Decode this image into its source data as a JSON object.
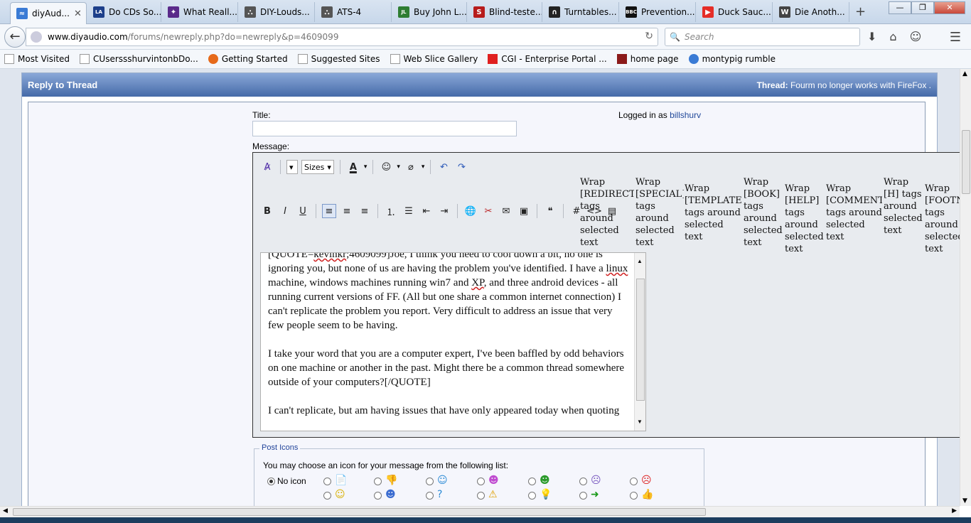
{
  "browser": {
    "tabs": [
      {
        "label": "diyAud...",
        "favicon": "diyaudio-icon",
        "color": "#3a7bd5"
      },
      {
        "label": "Do CDs So...",
        "favicon": "la-icon",
        "color": "#1d3f8a"
      },
      {
        "label": "What Reall...",
        "favicon": "dancer-icon",
        "color": "#5a2a8a"
      },
      {
        "label": "DIY-Louds...",
        "favicon": "tower-icon",
        "color": "#555555"
      },
      {
        "label": "ATS-4",
        "favicon": "tower-icon",
        "color": "#555555"
      },
      {
        "label": "Buy John L...",
        "favicon": "jl-icon",
        "color": "#2e7d32"
      },
      {
        "label": "Blind-teste...",
        "favicon": "s-icon",
        "color": "#b71c1c"
      },
      {
        "label": "Turntables...",
        "favicon": "headphones-icon",
        "color": "#222222"
      },
      {
        "label": "Prevention...",
        "favicon": "bbc-icon",
        "color": "#111111"
      },
      {
        "label": "Duck Sauc...",
        "favicon": "youtube-icon",
        "color": "#e52d27"
      },
      {
        "label": "Die Anoth...",
        "favicon": "wikipedia-icon",
        "color": "#444444"
      }
    ],
    "url_host": "www.diyaudio.com",
    "url_path": "/forums/newreply.php?do=newreply&p=4609099",
    "search_placeholder": "Search",
    "bookmarks": [
      "Most Visited",
      "CUserssshurvintonbDo...",
      "Getting Started",
      "Suggested Sites",
      "Web Slice Gallery",
      "CGI - Enterprise Portal ...",
      "home page",
      "montypig rumble"
    ]
  },
  "panel": {
    "title": "Reply to Thread",
    "thread_label": "Thread:",
    "thread_title": "Fourm no longer works with FireFox ."
  },
  "form": {
    "title_label": "Title:",
    "title_value": "",
    "logged_in_label": "Logged in as",
    "username": "billshurv",
    "message_label": "Message:",
    "sizes_label": "Sizes"
  },
  "wrap_buttons": [
    "Wrap [REDIRECT] tags around selected text",
    "Wrap [SPECIAL] tags around selected text",
    "Wrap [TEMPLATE] tags around selected text",
    "Wrap [BOOK] tags around selected text",
    "Wrap [HELP] tags around selected text",
    "Wrap [COMMENT] tags around selected text",
    "Wrap [H] tags around selected text",
    "Wrap [FOOTNOTE] tags around selected text"
  ],
  "message": {
    "quote_open_pre": "[QUOTE=",
    "quote_author": "kevinkr",
    "quote_open_post": ";4609099]Joe, I think you need to cool down a bit, no one is ignoring you, but none of us are having the problem you've identified. I have a ",
    "word_linux": "linux",
    "mid1": " machine, windows machines running win7 and ",
    "word_xp": "XP",
    "mid2": ", and three android devices - all running current versions of FF. (All but one share a common internet connection) I can't replicate the problem you report. Very difficult to address an issue that very few people seem to be having.",
    "para2": "I take your word that you are a computer expert, I've been baffled by odd behaviors on one machine or another in the past. Might there be a common thread somewhere outside of your computers?[/QUOTE]",
    "para3": "I can't replicate, but am having issues that have only appeared today when quoting"
  },
  "post_icons": {
    "legend": "Post Icons",
    "instruction": "You may choose an icon for your message from the following list:",
    "no_icon_label": "No icon",
    "icons": [
      "document-icon",
      "thumbs-down-icon",
      "smile-icon",
      "grin-icon",
      "alien-icon",
      "frown-icon",
      "angry-icon",
      "happy-icon",
      "cool-icon",
      "question-icon",
      "warning-icon",
      "lightbulb-icon",
      "arrow-right-icon",
      "thumbs-up-icon"
    ]
  }
}
